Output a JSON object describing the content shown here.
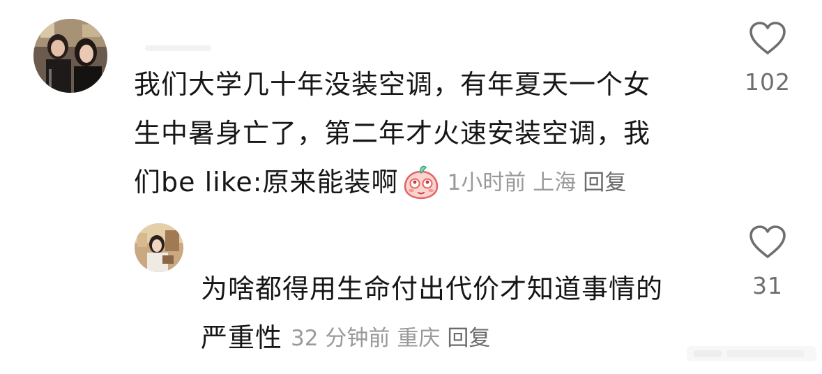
{
  "comments": [
    {
      "text_lines": [
        "我们大学几十年没装空调，有年夏天一个女",
        "生中暑身亡了，第二年才火速安装空调，我",
        "们be like:原来能装啊"
      ],
      "emoji": "peach-emoji-icon",
      "time": "1小时前",
      "location": "上海",
      "reply_label": "回复",
      "likes": "102"
    },
    {
      "text_lines": [
        "为啥都得用生命付出代价才知道事情的",
        "严重性"
      ],
      "time": "32 分钟前",
      "location": "重庆",
      "reply_label": "回复",
      "likes": "31"
    }
  ],
  "colors": {
    "text": "#161616",
    "meta": "#9a9a9a",
    "icon": "#6e6e6e",
    "background": "#ffffff"
  }
}
